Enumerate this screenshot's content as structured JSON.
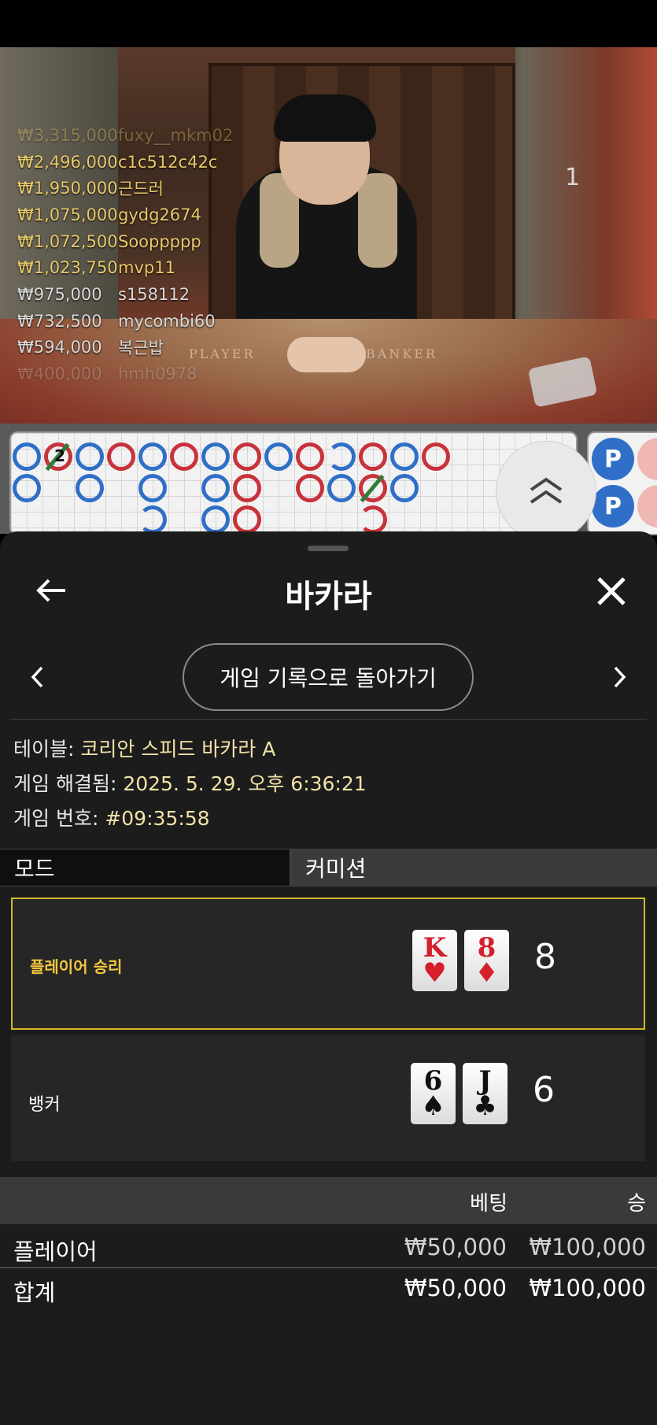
{
  "stream": {
    "table_number": "1",
    "felt_left": "PLAYER",
    "felt_right": "BANKER",
    "winners": [
      {
        "amount": "₩3,315,000",
        "name": "fuxy__mkm02"
      },
      {
        "amount": "₩2,496,000",
        "name": "c1c512c42c"
      },
      {
        "amount": "₩1,950,000",
        "name": "근드러"
      },
      {
        "amount": "₩1,075,000",
        "name": "gydg2674"
      },
      {
        "amount": "₩1,072,500",
        "name": "Sooppppp"
      },
      {
        "amount": "₩1,023,750",
        "name": "mvp11"
      },
      {
        "amount": "₩975,000",
        "name": "s158112"
      },
      {
        "amount": "₩732,500",
        "name": "mycombi60"
      },
      {
        "amount": "₩594,000",
        "name": "복근밥"
      },
      {
        "amount": "₩400,000",
        "name": "hmh0978"
      }
    ]
  },
  "roadmap": {
    "tie_count_label": "2",
    "side_beads": [
      "P",
      "P"
    ]
  },
  "sheet": {
    "title": "바카라",
    "back_to_history": "게임 기록으로 돌아가기",
    "info": {
      "table_label": "테이블: ",
      "table_value": "코리안 스피드 바카라 A",
      "resolved_label": "게임 해결됨: ",
      "resolved_value": "2025. 5. 29. 오후 6:36:21",
      "game_no_label": "게임 번호: ",
      "game_no_value": "#09:35:58"
    },
    "mode_label": "모드",
    "commission_label": "커미션",
    "player": {
      "label": "플레이어 승리",
      "cards": [
        {
          "rank": "K",
          "suit": "♥"
        },
        {
          "rank": "8",
          "suit": "♦"
        }
      ],
      "score": "8"
    },
    "banker": {
      "label": "뱅커",
      "cards": [
        {
          "rank": "6",
          "suit": "♠"
        },
        {
          "rank": "J",
          "suit": "♣"
        }
      ],
      "score": "6"
    },
    "bets": {
      "col_bet": "베팅",
      "col_win": "승",
      "rows": [
        {
          "label": "플레이어",
          "bet": "₩50,000",
          "win": "₩100,000"
        },
        {
          "label": "합계",
          "bet": "₩50,000",
          "win": "₩100,000"
        }
      ]
    }
  },
  "colors": {
    "accent_gold": "#d8b62a",
    "player_blue": "#2f6fc7",
    "banker_red": "#c8323a",
    "card_red": "#d4202c"
  }
}
